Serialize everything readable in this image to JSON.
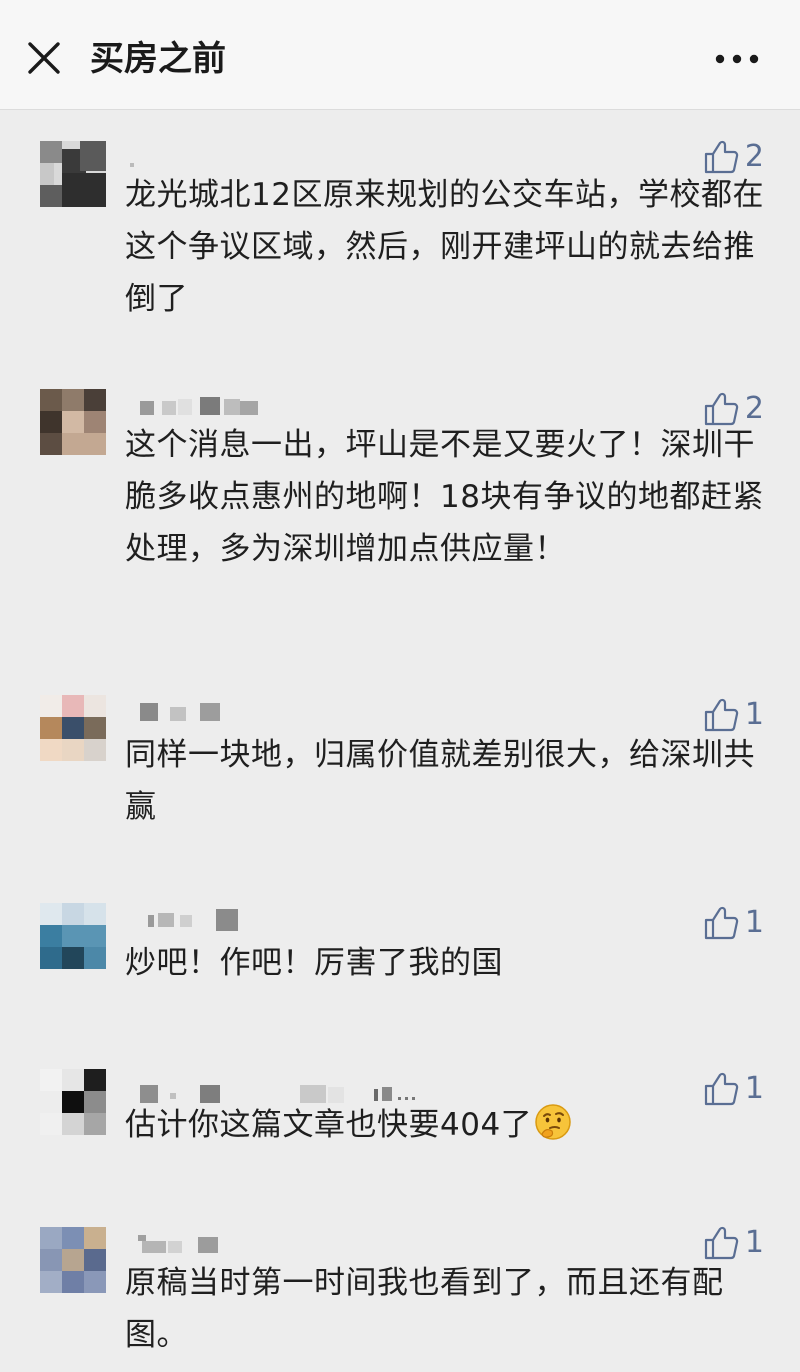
{
  "header": {
    "close_icon": "close-icon",
    "title": "买房之前",
    "more_icon": "more-dots-icon"
  },
  "comments": [
    {
      "like_count": "2",
      "text": "龙光城北12区原来规划的公交车站，学校都在这个争议区域，然后，刚开建坪山的就去给推倒了"
    },
    {
      "like_count": "2",
      "text": "这个消息一出，坪山是不是又要火了！深圳干脆多收点惠州的地啊！18块有争议的地都赶紧处理，多为深圳增加点供应量！"
    },
    {
      "like_count": "1",
      "text": "同样一块地，归属价值就差别很大，给深圳共赢"
    },
    {
      "like_count": "1",
      "text": "炒吧！作吧！厉害了我的国"
    },
    {
      "like_count": "1",
      "text": "估计你这篇文章也快要404了",
      "emoji": "thinking-face-emoji"
    },
    {
      "like_count": "1",
      "text": "原稿当时第一时间我也看到了，而且还有配图。"
    }
  ],
  "colors": {
    "background": "#ededed",
    "header_background": "#f7f7f7",
    "like_blue": "#5a6e93",
    "text": "#1f1f1f"
  }
}
